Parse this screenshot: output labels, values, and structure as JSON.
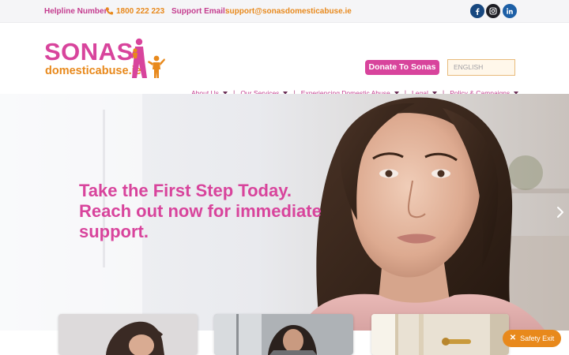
{
  "topbar": {
    "helpline_label": "Helpline Number:",
    "helpline_number": "1800 222 223",
    "support_label": "Support Email:",
    "support_email": "support@sonasdomesticabuse.ie",
    "social": [
      "facebook-icon",
      "instagram-icon",
      "linkedin-icon"
    ]
  },
  "header": {
    "logo_word": "SONAS",
    "logo_url": "domesticabuse.ie",
    "donate_label": "Donate To Sonas",
    "language": "ENGLISH",
    "nav": [
      {
        "label": "About Us"
      },
      {
        "label": "Our Services"
      },
      {
        "label": "Experiencing Domestic Abuse"
      },
      {
        "label": "Legal"
      },
      {
        "label": "Policy & Campaigns"
      }
    ]
  },
  "hero": {
    "title": "Take the First Step Today. Reach out now for immediate support."
  },
  "safety_exit": {
    "label": "Safety Exit"
  },
  "colors": {
    "brand_pink": "#d8449c",
    "brand_orange": "#e8891c",
    "nav_text": "#c43d8f"
  }
}
